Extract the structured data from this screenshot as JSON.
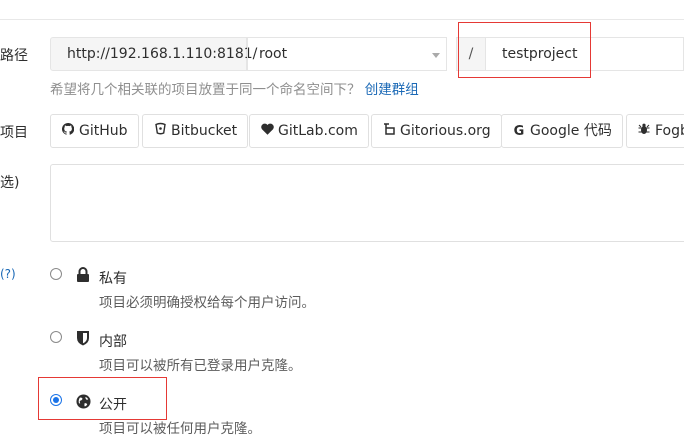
{
  "labels": {
    "path": "路径",
    "import": "项目",
    "description": "选)",
    "visibility_help": "(?)"
  },
  "path_row": {
    "url_prefix": "http://192.168.1.110:8181/",
    "namespace": "root",
    "slash": "/",
    "project_name": "testproject"
  },
  "hint": {
    "text": "希望将几个相关联的项目放置于同一个命名空间下？",
    "link": "创建群组"
  },
  "import_buttons": [
    {
      "label": "GitHub",
      "icon": "github-icon"
    },
    {
      "label": "Bitbucket",
      "icon": "bitbucket-icon"
    },
    {
      "label": "GitLab.com",
      "icon": "heart-icon"
    },
    {
      "label": "Gitorious.org",
      "icon": "gitorious-icon"
    },
    {
      "label": "Google 代码",
      "icon": "google-icon"
    },
    {
      "label": "Fogb",
      "icon": "bug-icon"
    }
  ],
  "visibility": [
    {
      "title": "私有",
      "desc": "项目必须明确授权给每个用户访问。",
      "icon": "lock-icon",
      "checked": false
    },
    {
      "title": "内部",
      "desc": "项目可以被所有已登录用户克隆。",
      "icon": "shield-icon",
      "checked": false
    },
    {
      "title": "公开",
      "desc": "项目可以被任何用户克隆。",
      "icon": "globe-icon",
      "checked": true
    }
  ],
  "colors": {
    "accent_link": "#1b69b6",
    "highlight_box": "#e53935",
    "radio_checked": "#1a73e8"
  }
}
